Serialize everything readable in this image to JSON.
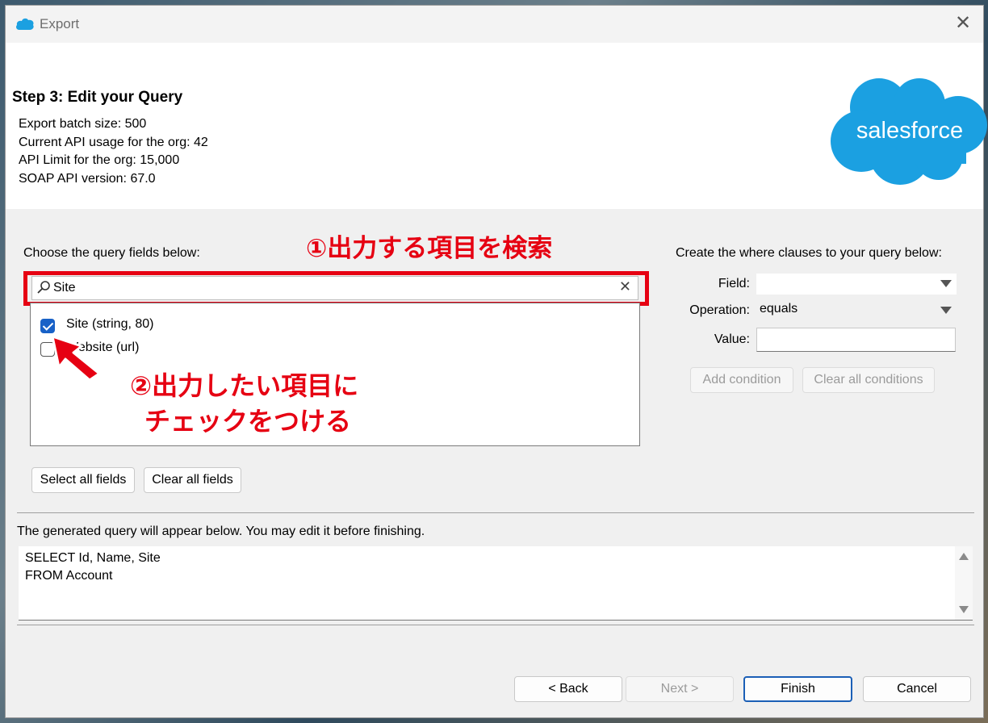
{
  "window": {
    "title": "Export",
    "close_glyph": "✕"
  },
  "header": {
    "step_title": "Step 3: Edit your Query",
    "info": [
      "Export batch size: 500",
      "Current API usage for the org: 42",
      "API Limit for the org: 15,000",
      "SOAP API version: 67.0"
    ],
    "logo_text": "salesforce",
    "brand_color": "#1ba0e1"
  },
  "fields_panel": {
    "label": "Choose the query fields below:",
    "search_value": "Site",
    "clear_glyph": "✕",
    "items": [
      {
        "label": "Site (string, 80)",
        "checked": true
      },
      {
        "label": "Website (url)",
        "checked": false
      }
    ],
    "select_all": "Select all fields",
    "clear_all": "Clear all fields"
  },
  "where_panel": {
    "label": "Create the where clauses to your query below:",
    "field_label": "Field:",
    "field_value": "",
    "operation_label": "Operation:",
    "operation_value": "equals",
    "value_label": "Value:",
    "value_value": "",
    "add_condition": "Add condition",
    "clear_conditions": "Clear all conditions"
  },
  "query": {
    "label": "The generated query will appear below.  You may edit it before finishing.",
    "lines": [
      "SELECT Id, Name, Site",
      "FROM Account"
    ]
  },
  "footer": {
    "back": "< Back",
    "next": "Next >",
    "finish": "Finish",
    "cancel": "Cancel"
  },
  "annotations": {
    "note1": "①出力する項目を検索",
    "note2_line1": "②出力したい項目に",
    "note2_line2": "チェックをつける",
    "accent": "#e60012"
  }
}
